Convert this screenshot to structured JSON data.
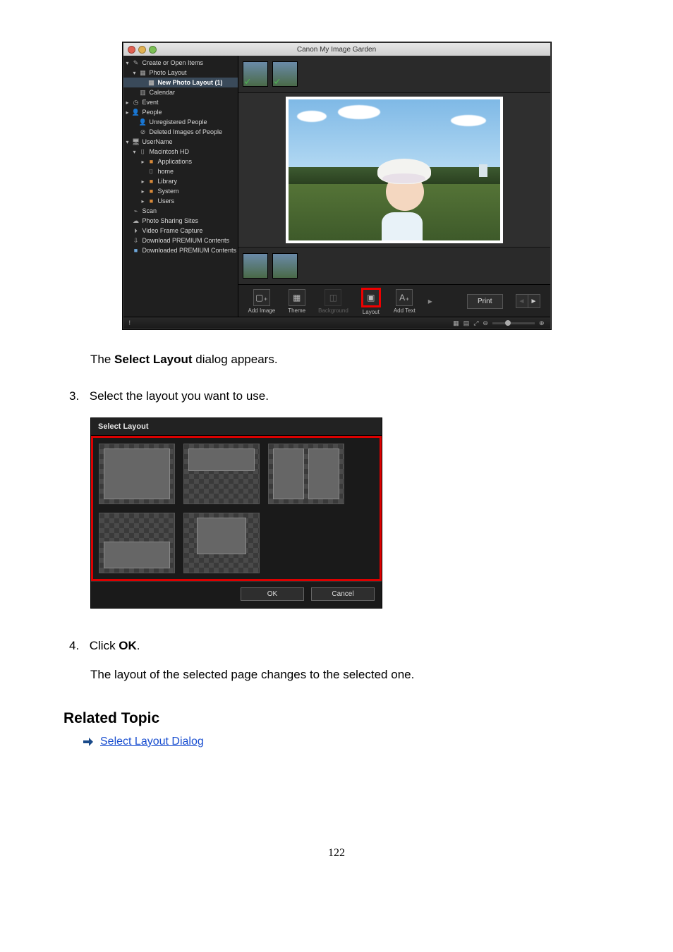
{
  "page_number": "122",
  "app": {
    "title": "Canon My Image Garden",
    "sidebar": {
      "items": [
        {
          "label": "Create or Open Items",
          "indent": 0,
          "arrow": "down",
          "icon": "pencil",
          "iconClass": "icon-grey"
        },
        {
          "label": "Photo Layout",
          "indent": 1,
          "arrow": "down",
          "icon": "grid",
          "iconClass": "icon-grey"
        },
        {
          "label": "New Photo Layout (1)",
          "indent": 2,
          "arrow": "",
          "icon": "grid",
          "iconClass": "icon-grey",
          "selected": true
        },
        {
          "label": "Calendar",
          "indent": 1,
          "arrow": "",
          "icon": "calendar",
          "iconClass": "icon-grey"
        },
        {
          "label": "Event",
          "indent": 0,
          "arrow": "right",
          "icon": "event",
          "iconClass": "icon-grey"
        },
        {
          "label": "People",
          "indent": 0,
          "arrow": "right",
          "icon": "person",
          "iconClass": "icon-grey"
        },
        {
          "label": "Unregistered People",
          "indent": 1,
          "arrow": "",
          "icon": "person",
          "iconClass": "icon-grey"
        },
        {
          "label": "Deleted Images of People",
          "indent": 1,
          "arrow": "",
          "icon": "person-off",
          "iconClass": "icon-grey"
        },
        {
          "label": "UserName",
          "indent": 0,
          "arrow": "down",
          "icon": "computer",
          "iconClass": "icon-grey"
        },
        {
          "label": "Macintosh HD",
          "indent": 1,
          "arrow": "down",
          "icon": "drive",
          "iconClass": "icon-grey"
        },
        {
          "label": "Applications",
          "indent": 2,
          "arrow": "right",
          "icon": "folder",
          "iconClass": "folder-orange"
        },
        {
          "label": "home",
          "indent": 2,
          "arrow": "",
          "icon": "drive",
          "iconClass": "icon-grey"
        },
        {
          "label": "Library",
          "indent": 2,
          "arrow": "right",
          "icon": "folder",
          "iconClass": "folder-orange"
        },
        {
          "label": "System",
          "indent": 2,
          "arrow": "right",
          "icon": "folder",
          "iconClass": "folder-orange"
        },
        {
          "label": "Users",
          "indent": 2,
          "arrow": "right",
          "icon": "folder",
          "iconClass": "folder-orange"
        },
        {
          "label": "Scan",
          "indent": 0,
          "arrow": "",
          "icon": "scanner",
          "iconClass": "icon-grey"
        },
        {
          "label": "Photo Sharing Sites",
          "indent": 0,
          "arrow": "",
          "icon": "share",
          "iconClass": "icon-grey"
        },
        {
          "label": "Video Frame Capture",
          "indent": 0,
          "arrow": "",
          "icon": "video",
          "iconClass": "icon-grey"
        },
        {
          "label": "Download PREMIUM Contents",
          "indent": 0,
          "arrow": "",
          "icon": "download",
          "iconClass": "icon-grey"
        },
        {
          "label": "Downloaded PREMIUM Contents",
          "indent": 0,
          "arrow": "",
          "icon": "folder",
          "iconClass": "folder-blue"
        }
      ]
    },
    "toolbar": {
      "add_image": "Add Image",
      "theme": "Theme",
      "background": "Background",
      "layout": "Layout",
      "add_text": "Add Text",
      "print": "Print"
    },
    "status": {
      "left": "!"
    }
  },
  "doc": {
    "para1_pre": "The ",
    "para1_bold": "Select Layout",
    "para1_post": " dialog appears.",
    "step3_num": "3.",
    "step3_text": "Select the layout you want to use.",
    "step4_num": "4.",
    "step4_pre": "Click ",
    "step4_bold": "OK",
    "step4_post": ".",
    "step4_result": "The layout of the selected page changes to the selected one."
  },
  "dialog": {
    "title": "Select Layout",
    "ok": "OK",
    "cancel": "Cancel"
  },
  "related": {
    "heading": "Related Topic",
    "link": "Select Layout Dialog"
  }
}
